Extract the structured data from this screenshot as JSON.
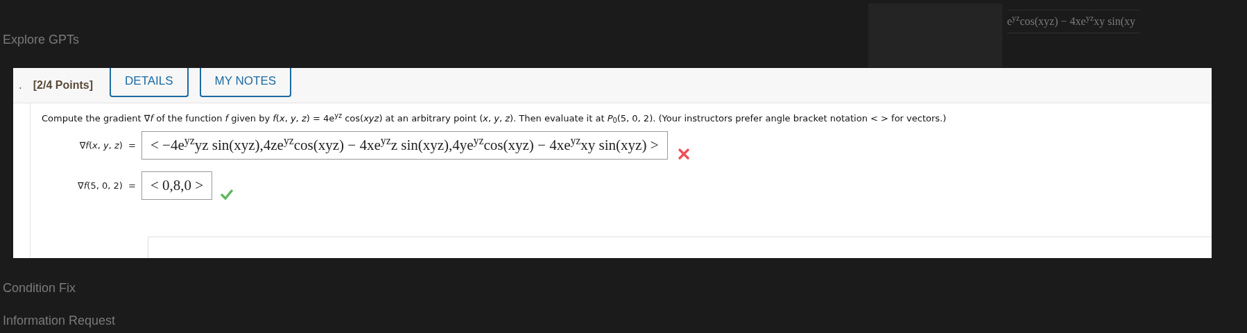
{
  "background": {
    "sidebar_items": [
      "Explore GPTs",
      "Condition Fix",
      "Information Request"
    ],
    "formula_fragment": "e$^{yz}$cos(xyz) − 4xe$^{yz}$xy sin(xy"
  },
  "question": {
    "number": ".",
    "points": "[2/4 Points]",
    "buttons": [
      "DETAILS",
      "MY NOTES"
    ],
    "prompt": "Compute the gradient ∇*f* of the function *f* given by *f*(*x*, *y*, *z*) = 4e$^{yz}$ cos(*xyz*) at an arbitrary point (*x*, *y*, *z*). Then evaluate it at *P*$_{0}$(5, 0, 2). (Your instructors prefer angle bracket notation < > for vectors.)",
    "answers": [
      {
        "label": "∇*f*(*x*, *y*, *z*)  =",
        "value": "< −4e$^{yz}$yz sin(xyz),4ze$^{yz}$cos(xyz) − 4xe$^{yz}$z sin(xyz),4ye$^{yz}$cos(xyz) − 4xe$^{yz}$xy sin(xyz) >",
        "correct": false
      },
      {
        "label": "∇*f*(5, 0, 2)  =",
        "value": "< 0,8,0 >",
        "correct": true
      }
    ]
  }
}
